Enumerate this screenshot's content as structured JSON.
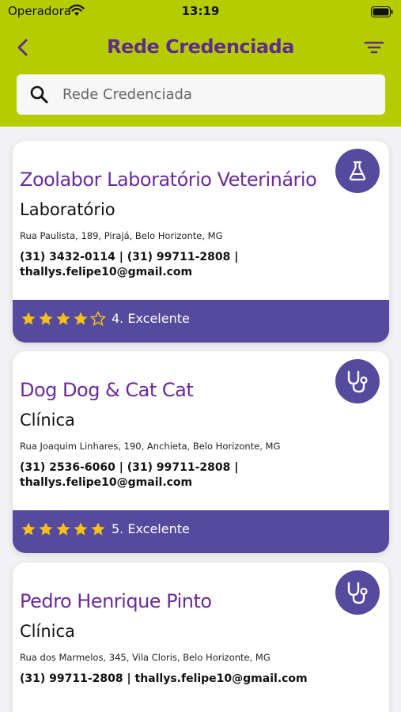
{
  "status_bar": {
    "carrier": "Operadora",
    "time": "13:19"
  },
  "navbar": {
    "title": "Rede Credenciada"
  },
  "search": {
    "placeholder": "Rede Credenciada"
  },
  "colors": {
    "header": "#b5cc00",
    "title": "#5e2d8c",
    "accent": "#554a9e",
    "star": "#f5c018"
  },
  "cards": [
    {
      "name": "Zoolabor Laboratório Veterinário",
      "type": "Laboratório",
      "address": "Rua Paulista, 189, Pirajá, Belo Horizonte, MG",
      "contact": "(31) 3432-0114 | (31) 99711-2808 | thallys.felipe10@gmail.com",
      "icon": "lab-flask-icon",
      "rating": 4,
      "rating_text": "4. Excelente"
    },
    {
      "name": "Dog Dog & Cat Cat",
      "type": "Clínica",
      "address": "Rua Joaquim Linhares, 190, Anchieta, Belo Horizonte, MG",
      "contact": "(31) 2536-6060 | (31) 99711-2808 | thallys.felipe10@gmail.com",
      "icon": "stethoscope-icon",
      "rating": 5,
      "rating_text": "5. Excelente"
    },
    {
      "name": "Pedro Henrique Pinto",
      "type": "Clínica",
      "address": "Rua dos Marmelos, 345, Vila Cloris, Belo Horizonte, MG",
      "contact": "(31) 99711-2808 | thallys.felipe10@gmail.com",
      "icon": "stethoscope-icon"
    }
  ]
}
